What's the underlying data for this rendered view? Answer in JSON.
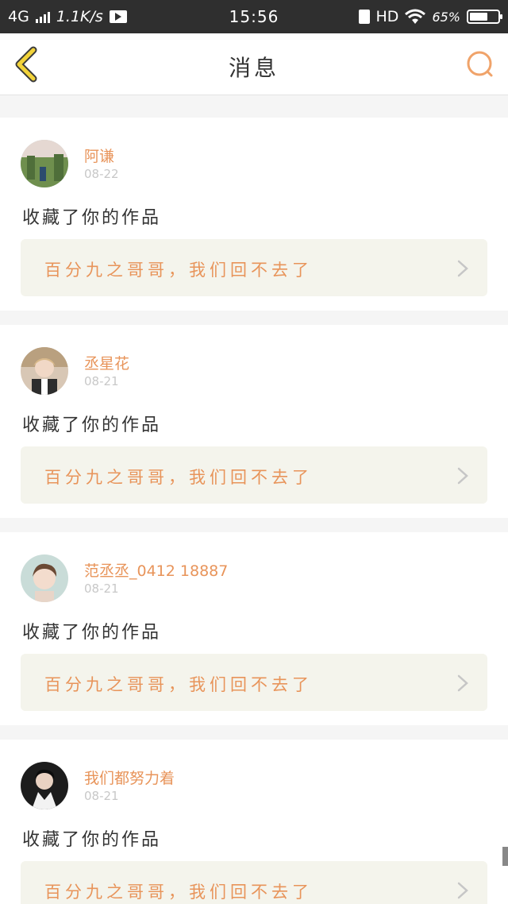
{
  "status_bar": {
    "network": "4G",
    "speed": "1.1K/s",
    "time": "15:56",
    "hd": "HD",
    "battery_text": "65%",
    "battery_level": 0.65
  },
  "nav": {
    "title": "消息",
    "back_icon": "chevron-left-icon",
    "search_icon": "search-icon"
  },
  "colors": {
    "accent": "#e8945a",
    "back_yellow": "#f2d33a",
    "card_bg": "#f4f4ec"
  },
  "notifications": [
    {
      "username": "阿谦",
      "date": "08-22",
      "action": "收藏了你的作品",
      "work_title": "百分九之哥哥，我们回不去了"
    },
    {
      "username": "丞星花",
      "date": "08-21",
      "action": "收藏了你的作品",
      "work_title": "百分九之哥哥，我们回不去了"
    },
    {
      "username": "范丞丞_0412 18887",
      "date": "08-21",
      "action": "收藏了你的作品",
      "work_title": "百分九之哥哥，我们回不去了"
    },
    {
      "username": "我们都努力着",
      "date": "08-21",
      "action": "收藏了你的作品",
      "work_title": "百分九之哥哥，我们回不去了"
    }
  ]
}
